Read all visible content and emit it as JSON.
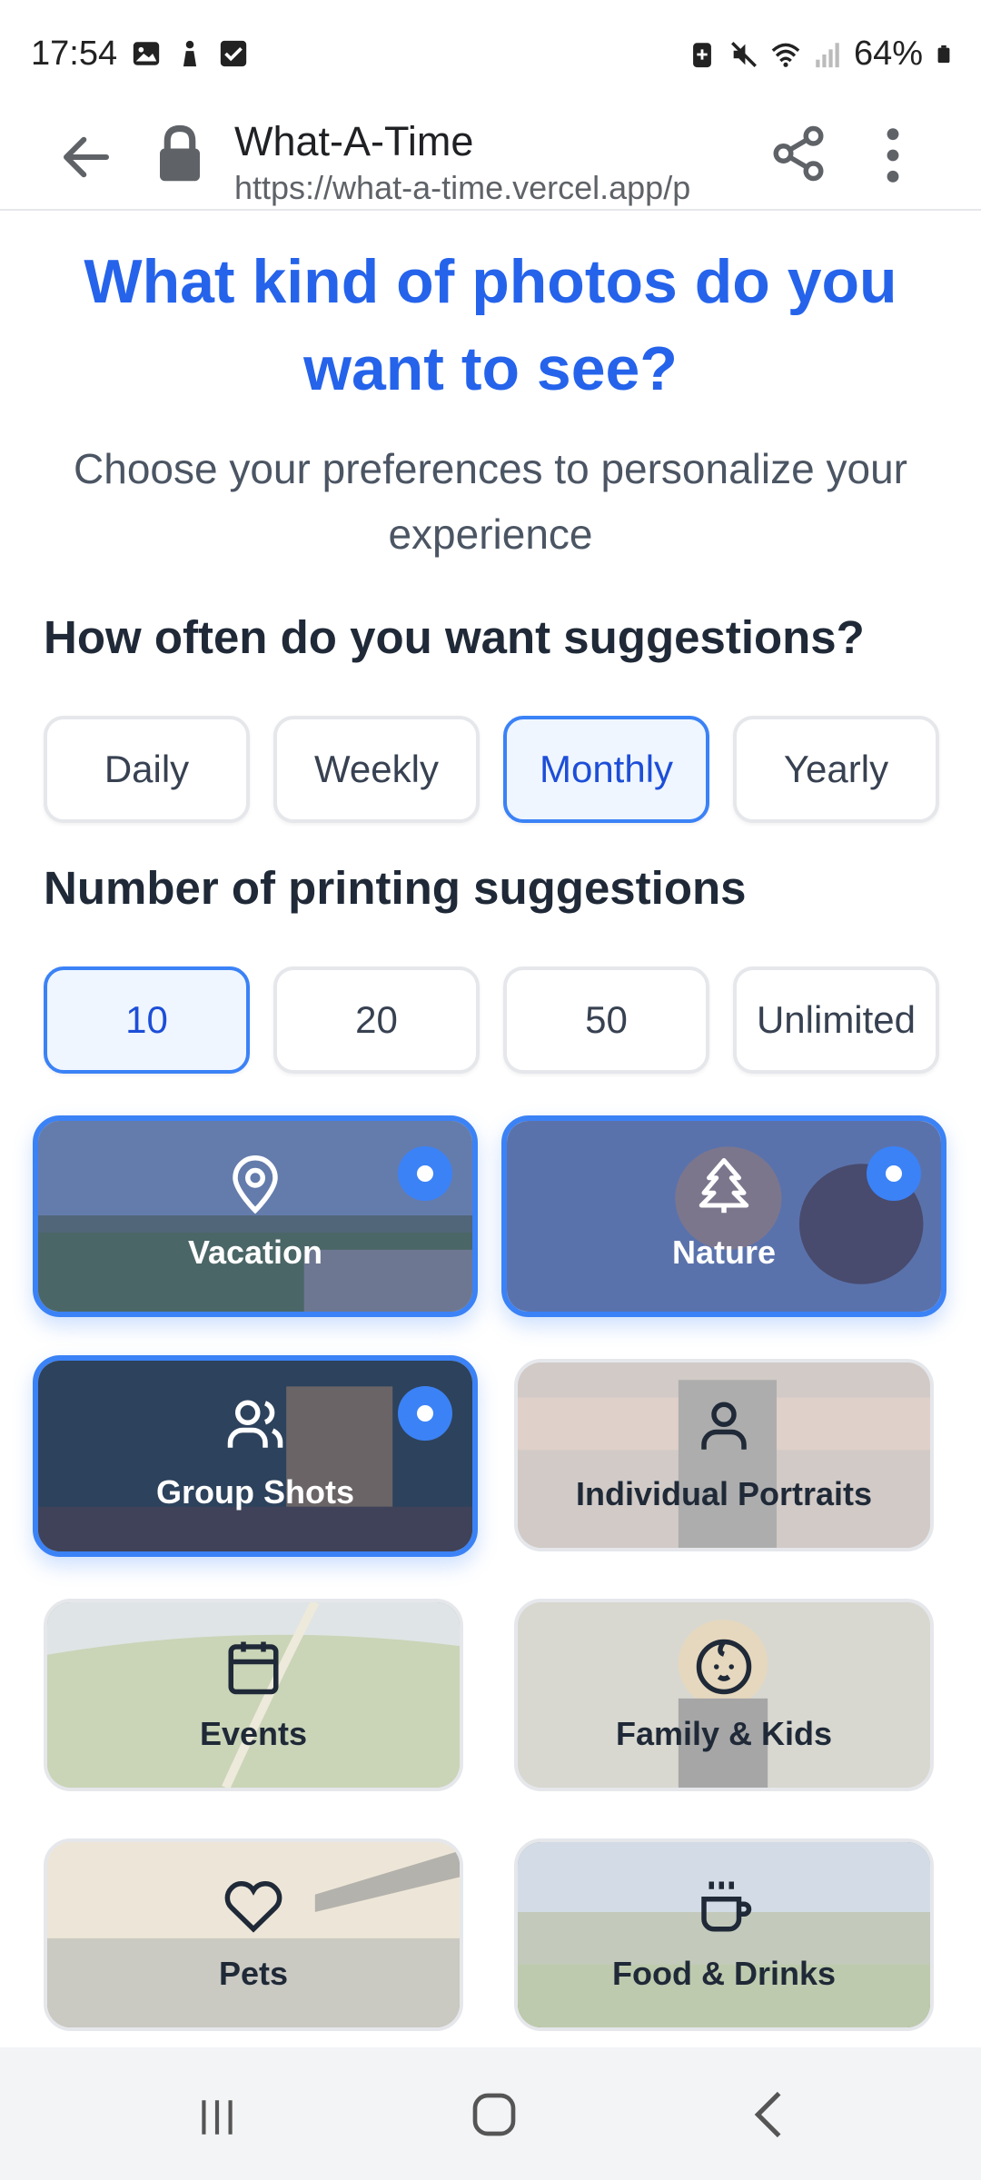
{
  "status_bar": {
    "time": "17:54",
    "battery": "64%",
    "left_icons": [
      "image-icon",
      "person-icon",
      "checkbox-icon"
    ],
    "right_icons": [
      "battery-saver-icon",
      "mute-icon",
      "wifi-icon",
      "signal-icon",
      "battery-icon"
    ]
  },
  "browser": {
    "title": "What-A-Time",
    "url": "https://what-a-time.vercel.app/p"
  },
  "page": {
    "headline": "What kind of photos do you want to see?",
    "subheadline": "Choose your preferences to personalize your experience",
    "frequency": {
      "title": "How often do you want suggestions?",
      "options": [
        "Daily",
        "Weekly",
        "Monthly",
        "Yearly"
      ],
      "selected": "Monthly"
    },
    "printing": {
      "title": "Number of printing suggestions",
      "options": [
        "10",
        "20",
        "50",
        "Unlimited"
      ],
      "selected": "10"
    },
    "categories": [
      {
        "label": "Vacation",
        "icon": "map-pin-icon",
        "selected": true
      },
      {
        "label": "Nature",
        "icon": "tree-icon",
        "selected": true
      },
      {
        "label": "Group Shots",
        "icon": "users-icon",
        "selected": true
      },
      {
        "label": "Individual Portraits",
        "icon": "user-icon",
        "selected": false
      },
      {
        "label": "Events",
        "icon": "calendar-icon",
        "selected": false
      },
      {
        "label": "Family & Kids",
        "icon": "baby-icon",
        "selected": false
      },
      {
        "label": "Pets",
        "icon": "heart-icon",
        "selected": false
      },
      {
        "label": "Food & Drinks",
        "icon": "coffee-icon",
        "selected": false
      }
    ]
  },
  "colors": {
    "accent": "#2563eb",
    "selected_border": "#3b82f6",
    "selected_bg": "#eff6ff"
  },
  "nav_icons": [
    "recent-apps-icon",
    "home-icon",
    "back-icon"
  ]
}
